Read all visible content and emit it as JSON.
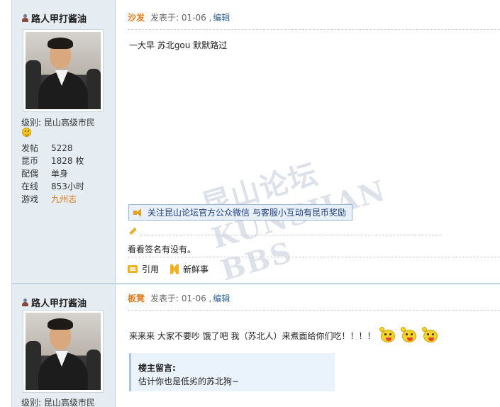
{
  "posts": [
    {
      "author": "路人甲打酱油",
      "level": "级别: 昆山高级市民",
      "stats": [
        {
          "label": "发帖",
          "value": "5228"
        },
        {
          "label": "昆币",
          "value": "1828 枚"
        },
        {
          "label": "配偶",
          "value": "单身"
        },
        {
          "label": "在线",
          "value": "853小时"
        },
        {
          "label": "游戏",
          "value": "九州志"
        }
      ],
      "floor": "沙发",
      "posted_at": "发表于: 01-06 ,",
      "edit": "编辑",
      "content": "一大早  苏北gou 默默路过",
      "watermark": "昆山论坛 KUNSHAN BBS",
      "promo": "关注昆山论坛官方公众微信 与客服小互动有昆币奖励",
      "signature": "看看签名有没有。",
      "actions": {
        "quote": "引用",
        "news": "新鲜事"
      }
    },
    {
      "author": "路人甲打酱油",
      "level": "级别: 昆山高级市民",
      "floor": "板凳",
      "posted_at": "发表于: 01-06 ,",
      "edit": "编辑",
      "content": "来来来  大家不要吵   饿了吧  我（苏北人）来煮面给你们吃！！！！",
      "owner_note": {
        "title": "楼主留言:",
        "text": "估计你也是低劣的苏北狗~"
      }
    }
  ],
  "icons": [
    "user-icon",
    "smiley-icon",
    "speaker-icon",
    "pencil-icon",
    "quote-icon",
    "news-icon",
    "emoji-tongue-icon"
  ],
  "colors": {
    "sidebar_bg": "#e5edf2",
    "floor": "#e07a1a",
    "link": "#336699",
    "promo_bg": "#e8f0fb"
  }
}
